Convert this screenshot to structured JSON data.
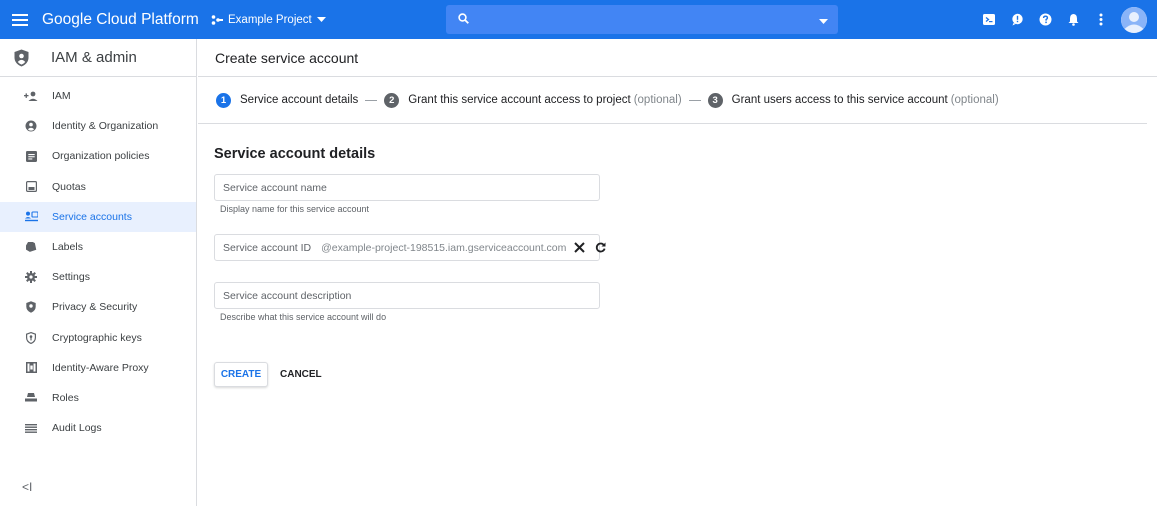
{
  "topbar": {
    "brand": "Google Cloud Platform",
    "project": "Example Project",
    "search_placeholder": "",
    "icons": [
      "cloud-shell-icon",
      "notifications-feedback-icon",
      "help-icon",
      "bell-icon",
      "more-vert-icon",
      "account-avatar-icon"
    ]
  },
  "sidebar": {
    "title": "IAM & admin",
    "items": [
      {
        "label": "IAM",
        "icon": "person-add-icon"
      },
      {
        "label": "Identity & Organization",
        "icon": "account-circle-icon"
      },
      {
        "label": "Organization policies",
        "icon": "policy-doc-icon"
      },
      {
        "label": "Quotas",
        "icon": "quota-icon"
      },
      {
        "label": "Service accounts",
        "icon": "service-account-icon",
        "active": true
      },
      {
        "label": "Labels",
        "icon": "label-icon"
      },
      {
        "label": "Settings",
        "icon": "gear-icon"
      },
      {
        "label": "Privacy & Security",
        "icon": "shield-icon"
      },
      {
        "label": "Cryptographic keys",
        "icon": "key-shield-icon"
      },
      {
        "label": "Identity-Aware Proxy",
        "icon": "proxy-icon"
      },
      {
        "label": "Roles",
        "icon": "roles-icon"
      },
      {
        "label": "Audit Logs",
        "icon": "list-icon"
      }
    ],
    "collapse_label": "<I"
  },
  "main": {
    "title": "Create service account",
    "steps": [
      {
        "num": "1",
        "label": "Service account details",
        "optional": ""
      },
      {
        "num": "2",
        "label": "Grant this service account access to project",
        "optional": "(optional)"
      },
      {
        "num": "3",
        "label": "Grant users access to this service account",
        "optional": "(optional)"
      }
    ],
    "section_title": "Service account details",
    "name_field": {
      "placeholder": "Service account name",
      "hint": "Display name for this service account"
    },
    "id_field": {
      "label": "Service account ID",
      "suffix": "@example-project-198515.iam.gserviceaccount.com"
    },
    "description_field": {
      "placeholder": "Service account description",
      "hint": "Describe what this service account will do"
    },
    "create_label": "CREATE",
    "cancel_label": "CANCEL"
  },
  "colors": {
    "accent": "#1a73e8",
    "search": "#4285f4",
    "active_bg": "#e8f0fe"
  }
}
